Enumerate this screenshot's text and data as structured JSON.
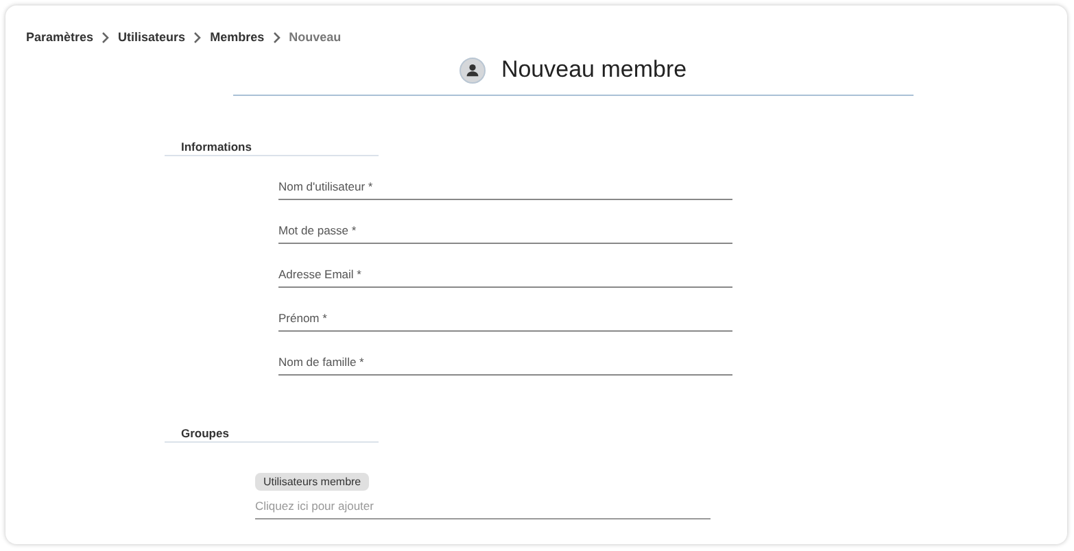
{
  "breadcrumb": [
    {
      "label": "Paramètres",
      "current": false
    },
    {
      "label": "Utilisateurs",
      "current": false
    },
    {
      "label": "Membres",
      "current": false
    },
    {
      "label": "Nouveau",
      "current": true
    }
  ],
  "title": "Nouveau membre",
  "sections": [
    {
      "heading": "Informations",
      "kind": "fields",
      "fields": [
        "Nom d'utilisateur *",
        "Mot de passe *",
        "Adresse Email *",
        "Prénom *",
        "Nom de famille *"
      ]
    },
    {
      "heading": "Groupes",
      "kind": "chips",
      "chips": [
        "Utilisateurs membre"
      ],
      "placeholder": "Cliquez ici pour ajouter"
    }
  ]
}
